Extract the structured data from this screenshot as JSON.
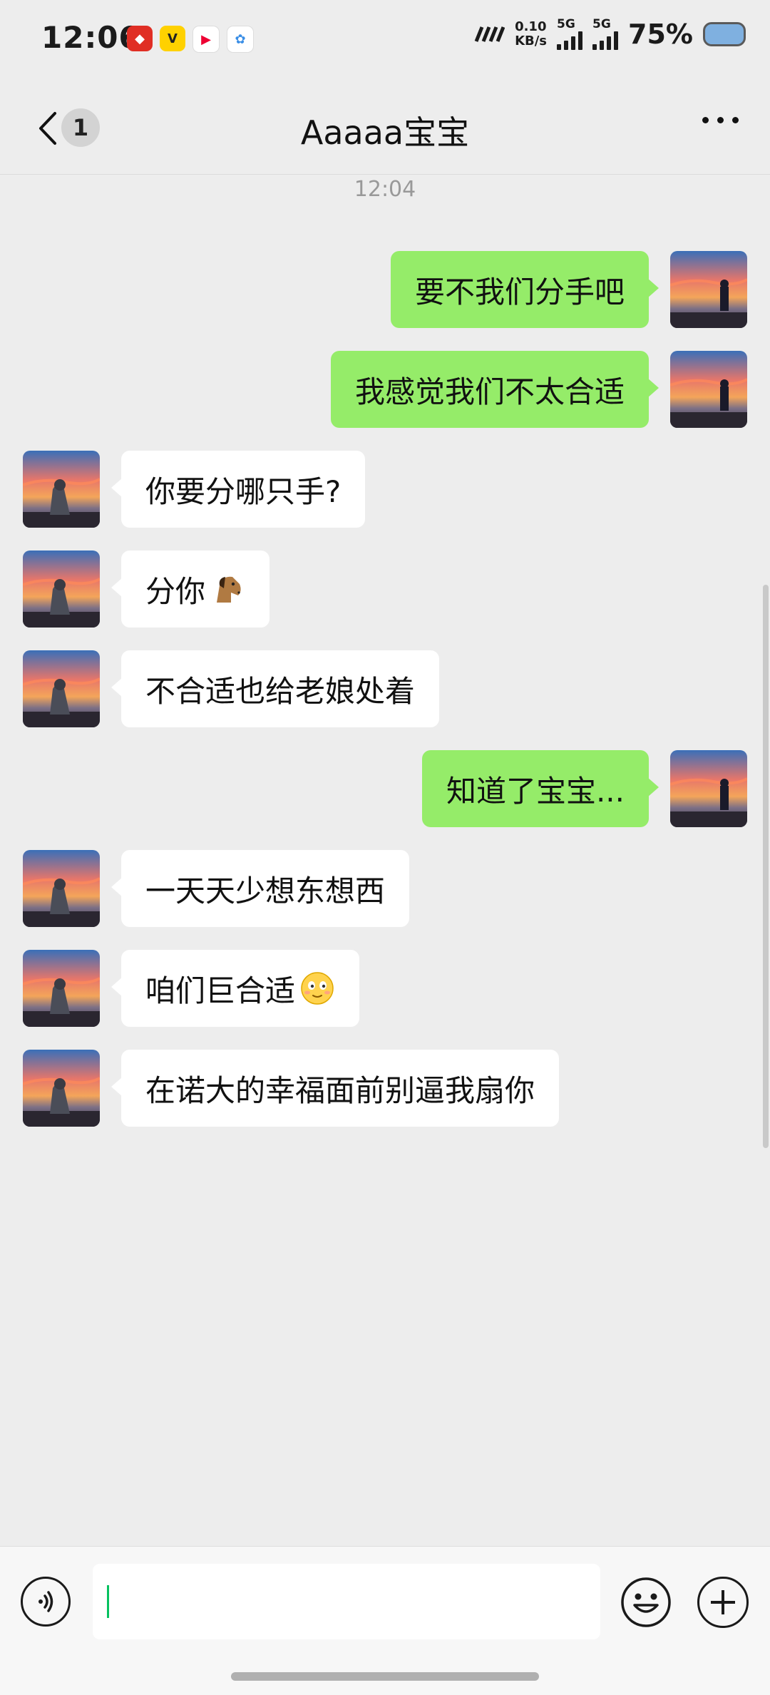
{
  "status_bar": {
    "time": "12:06",
    "speed_value": "0.10",
    "speed_unit": "KB/s",
    "network1": "5G",
    "network2": "5G",
    "battery": "75%",
    "app_icons": [
      "pinduoduo-icon",
      "meituan-icon",
      "app-icon",
      "app-icon"
    ]
  },
  "header": {
    "unread_count": "1",
    "title": "Aaaaa宝宝"
  },
  "timestamp": "12:04",
  "messages": [
    {
      "side": "right",
      "text": "要不我们分手吧"
    },
    {
      "side": "right",
      "text": "我感觉我们不太合适"
    },
    {
      "side": "left",
      "text": "你要分哪只手?"
    },
    {
      "side": "left",
      "text": "分你",
      "emoji": "horse-face-icon"
    },
    {
      "side": "left",
      "text": "不合适也给老娘处着"
    },
    {
      "side": "right",
      "text": "知道了宝宝..."
    },
    {
      "side": "left",
      "text": "一天天少想东想西"
    },
    {
      "side": "left",
      "text": "咱们巨合适",
      "emoji": "flushed-smile-icon"
    },
    {
      "side": "left",
      "text": "在诺大的幸福面前别逼我扇你"
    }
  ],
  "input": {
    "value": "",
    "voice_icon": "voice-icon",
    "emoji_icon": "emoji-icon",
    "plus_icon": "plus-icon"
  },
  "colors": {
    "background": "#ededed",
    "sent_bubble": "#95ec69",
    "received_bubble": "#ffffff",
    "cursor": "#07c160"
  }
}
